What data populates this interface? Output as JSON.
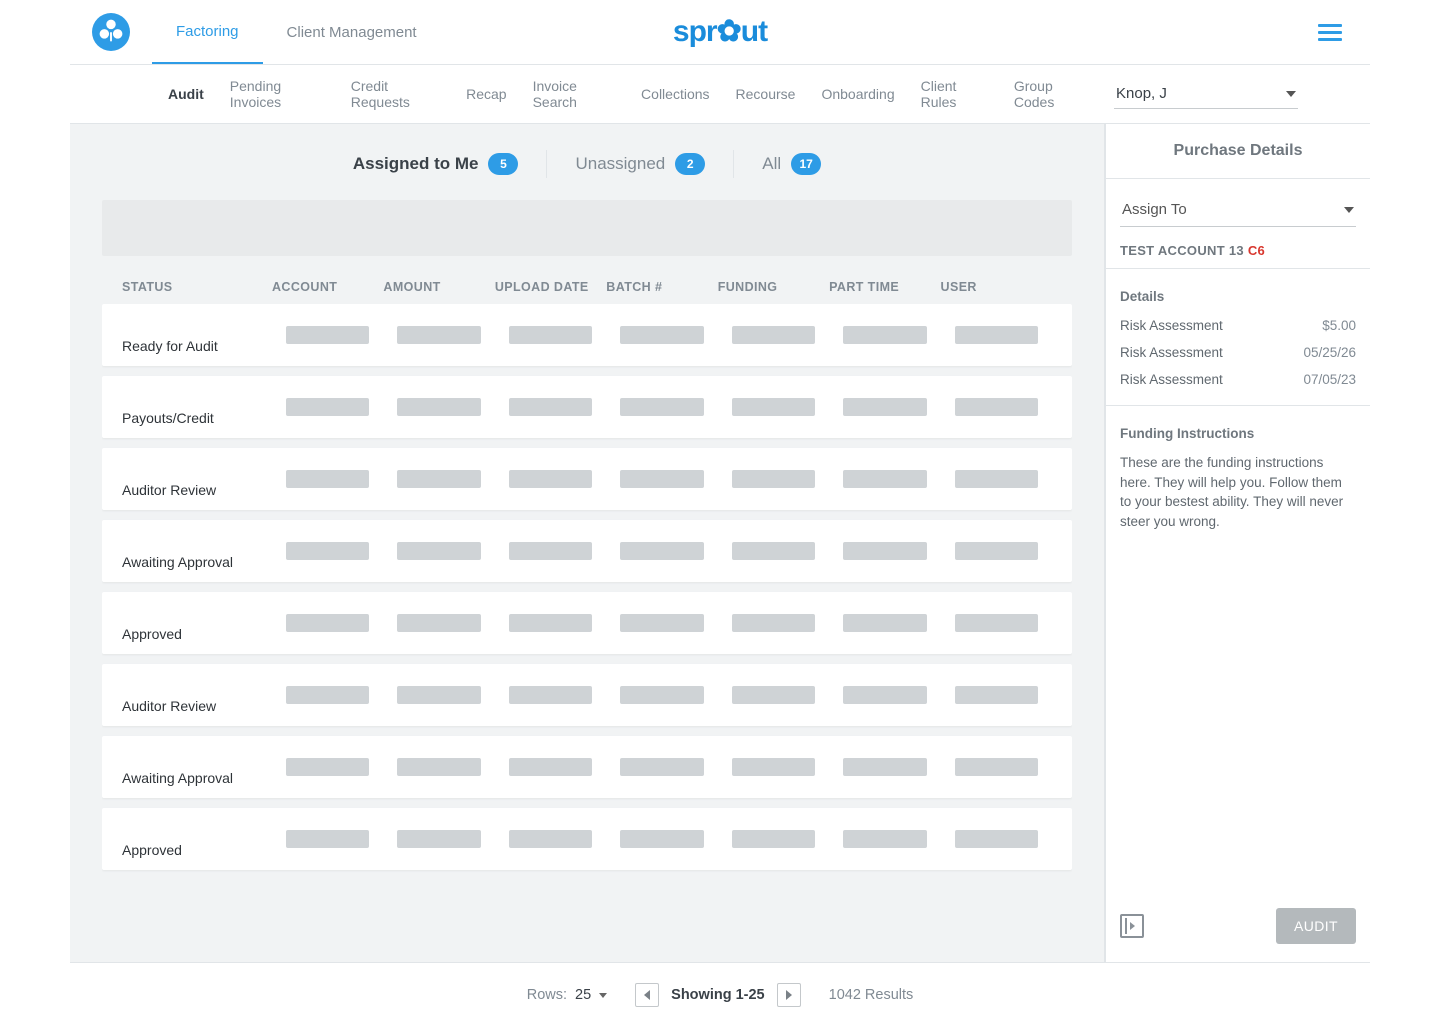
{
  "brand": "sprout",
  "top_tabs": {
    "factoring": "Factoring",
    "client_mgmt": "Client Management"
  },
  "subnav": {
    "audit": "Audit",
    "pending_invoices": "Pending Invoices",
    "credit_requests": "Credit Requests",
    "recap": "Recap",
    "invoice_search": "Invoice Search",
    "collections": "Collections",
    "recourse": "Recourse",
    "onboarding": "Onboarding",
    "client_rules": "Client Rules",
    "group_codes": "Group Codes"
  },
  "user_select": {
    "value": "Knop, J"
  },
  "filter_tabs": {
    "assigned": {
      "label": "Assigned to Me",
      "count": "5"
    },
    "unassigned": {
      "label": "Unassigned",
      "count": "2"
    },
    "all": {
      "label": "All",
      "count": "17"
    }
  },
  "columns": {
    "status": "STATUS",
    "account": "ACCOUNT",
    "amount": "AMOUNT",
    "upload_date": "UPLOAD DATE",
    "batch": "BATCH #",
    "funding": "FUNDING",
    "part_time": "PART TIME",
    "user": "USER"
  },
  "statuses": [
    "Ready for Audit",
    "Payouts/Credit",
    "Auditor Review",
    "Awaiting Approval",
    "Approved",
    "Auditor Review",
    "Awaiting Approval",
    "Approved"
  ],
  "pagination": {
    "rows_label": "Rows:",
    "rows_value": "25",
    "showing": "Showing 1-25",
    "results": "1042 Results"
  },
  "side": {
    "title": "Purchase Details",
    "assign_label": "Assign To",
    "account_name": "TEST ACCOUNT 13",
    "account_code": "C6",
    "details_header": "Details",
    "details": [
      {
        "k": "Risk Assessment",
        "v": "$5.00"
      },
      {
        "k": "Risk Assessment",
        "v": "05/25/26"
      },
      {
        "k": "Risk Assessment",
        "v": "07/05/23"
      }
    ],
    "instructions_header": "Funding Instructions",
    "instructions_body": "These are the funding instructions here. They will help you. Follow them to your bestest ability. They will never steer you wrong.",
    "audit_button": "AUDIT"
  }
}
